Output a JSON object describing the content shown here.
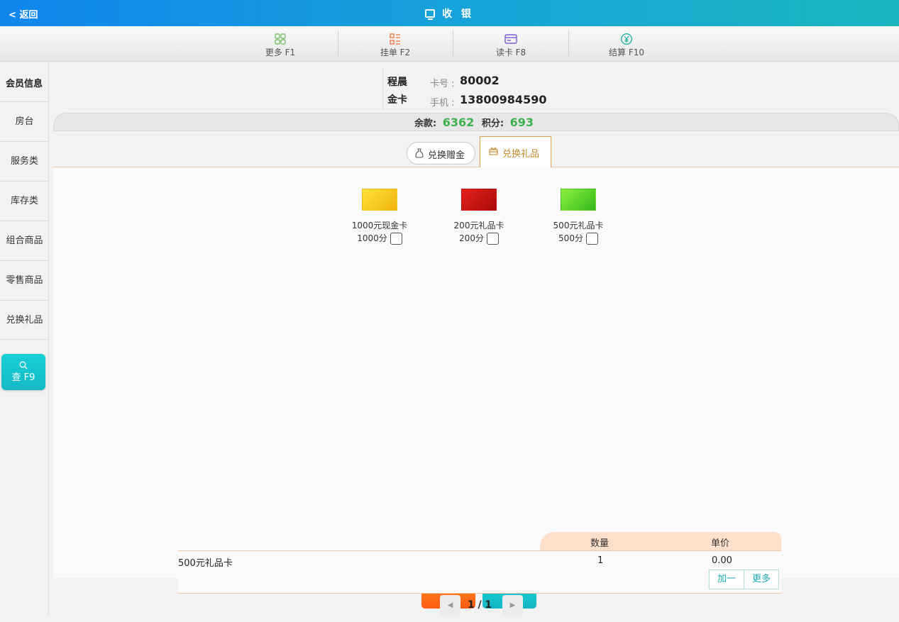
{
  "header": {
    "back_label": "< 返回",
    "title": "收 银"
  },
  "toolbar": [
    {
      "label": "更多 F1",
      "icon": "grid-icon",
      "color": "#7cc06a"
    },
    {
      "label": "挂单 F2",
      "icon": "list-icon",
      "color": "#f07a4a"
    },
    {
      "label": "读卡 F8",
      "icon": "card-icon",
      "color": "#7a5cc8"
    },
    {
      "label": "结算 F10",
      "icon": "yen-icon",
      "color": "#22b3a3"
    }
  ],
  "sidebar": {
    "heading": "会员信息",
    "items": [
      "房台",
      "服务类",
      "库存类",
      "组合商品",
      "零售商品",
      "兑换礼品"
    ],
    "search_label": "查 F9"
  },
  "member": {
    "name": "程晨",
    "level": "金卡",
    "card_label": "卡号 :",
    "card_no": "80002",
    "phone_label": "手机 :",
    "phone": "13800984590"
  },
  "balance": {
    "balance_label": "余款:",
    "balance_value": "6362",
    "points_label": "积分:",
    "points_value": "693"
  },
  "tabs": {
    "cash_label": "兑换赠金",
    "gift_label": "兑换礼品"
  },
  "gifts": [
    {
      "name": "1000元现金卡",
      "points": "1000分",
      "color": "#f4c20d"
    },
    {
      "name": "200元礼品卡",
      "points": "200分",
      "color": "#d81616"
    },
    {
      "name": "500元礼品卡",
      "points": "500分",
      "color": "#5fd41f"
    }
  ],
  "cart": {
    "col_qty": "数量",
    "col_price": "单价",
    "rows": [
      {
        "name": "500元礼品卡",
        "qty": "1",
        "price": "0.00"
      }
    ],
    "add_one": "加一",
    "more": "更多"
  },
  "pager": {
    "text": "1 / 1"
  }
}
